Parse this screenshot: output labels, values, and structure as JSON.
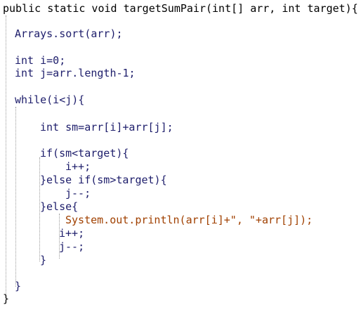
{
  "editor": {
    "colors": {
      "text": "#1d1d6b",
      "orange": "#a04000",
      "black": "#000000",
      "guide": "#9a9a9a"
    },
    "lines": [
      {
        "id": "l01",
        "text": "public static void targetSumPair(int[] arr, int target){"
      },
      {
        "id": "l02",
        "text": "Arrays.sort(arr);"
      },
      {
        "id": "l03",
        "text": "int i=0;"
      },
      {
        "id": "l04",
        "text": "int j=arr.length-1;"
      },
      {
        "id": "l05",
        "text": "while(i<j){"
      },
      {
        "id": "l06",
        "text": "int sm=arr[i]+arr[j];"
      },
      {
        "id": "l07",
        "text": "if(sm<target){"
      },
      {
        "id": "l08",
        "text": "i++;"
      },
      {
        "id": "l09",
        "text": "}else if(sm>target){"
      },
      {
        "id": "l10",
        "text": "j--;"
      },
      {
        "id": "l11",
        "text": "}else{"
      },
      {
        "id": "l12",
        "text": "System.out.println(arr[i]+\", \"+arr[j]);"
      },
      {
        "id": "l13",
        "text": "i++;"
      },
      {
        "id": "l14",
        "text": "j--;"
      },
      {
        "id": "l15",
        "text": "}"
      },
      {
        "id": "l16",
        "text": "}"
      },
      {
        "id": "l17",
        "text": "}"
      }
    ]
  }
}
